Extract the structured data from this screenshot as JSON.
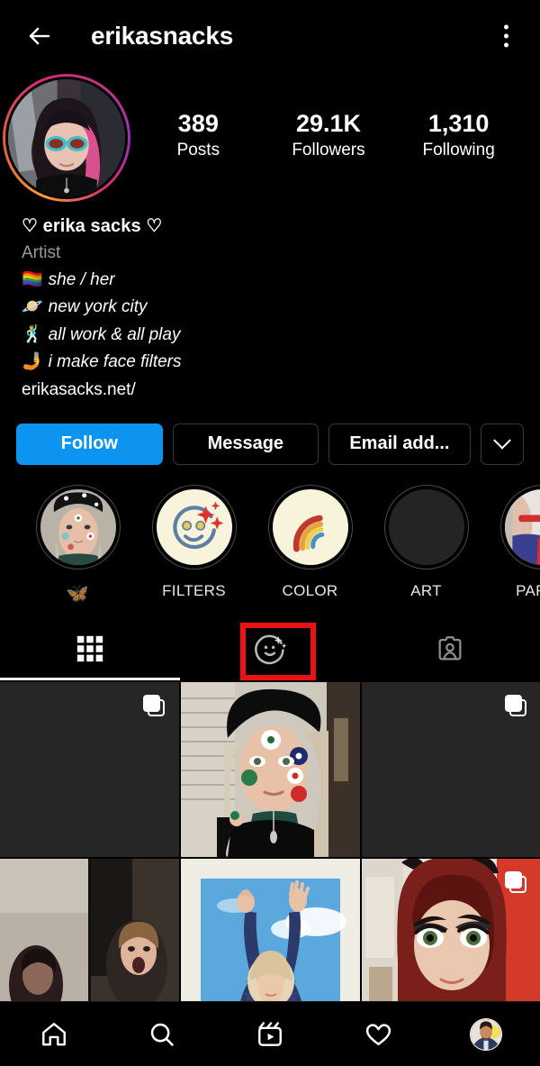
{
  "header": {
    "back_icon": "back-arrow-icon",
    "username": "erikasnacks",
    "menu_icon": "kebab-menu-icon"
  },
  "profile": {
    "avatar_name": "profile-avatar-with-story-ring",
    "has_story_ring": true,
    "stats": [
      {
        "value": "389",
        "label": "Posts"
      },
      {
        "value": "29.1K",
        "label": "Followers"
      },
      {
        "value": "1,310",
        "label": "Following"
      }
    ],
    "bio": {
      "display_name": "♡ erika sacks ♡",
      "category": "Artist",
      "lines": [
        {
          "emoji": "🏳️‍🌈",
          "text": "she / her"
        },
        {
          "emoji": "🪐",
          "text": "new york city"
        },
        {
          "emoji": "🕺",
          "text": "all work & all play"
        },
        {
          "emoji": "🤳",
          "text": "i make face filters"
        }
      ],
      "link": "erikasacks.net/"
    }
  },
  "actions": {
    "follow_label": "Follow",
    "message_label": "Message",
    "email_label": "Email add...",
    "chevron_icon": "chevron-down-icon",
    "follow_color": "#0d94f0"
  },
  "highlights": [
    {
      "label": "🦋",
      "icon": "highlight-cover-selfie",
      "is_emoji": true
    },
    {
      "label": "FILTERS",
      "icon": "highlight-cover-smiley-sparkles",
      "is_emoji": false
    },
    {
      "label": "COLOR",
      "icon": "highlight-cover-rainbow",
      "is_emoji": false
    },
    {
      "label": "ART",
      "icon": "highlight-cover-blank",
      "is_emoji": false
    },
    {
      "label": "PARAD",
      "icon": "highlight-cover-parade",
      "is_emoji": false
    }
  ],
  "tabs": [
    {
      "name": "grid-tab",
      "icon": "grid-icon",
      "active": true
    },
    {
      "name": "effects-tab",
      "icon": "face-effects-icon",
      "active": false,
      "highlighted": true
    },
    {
      "name": "tagged-tab",
      "icon": "tagged-person-icon",
      "active": false
    }
  ],
  "annotation": {
    "box_color": "#ee1111",
    "target": "effects-tab"
  },
  "grid": {
    "cells": [
      {
        "name": "post-dark-carousel-1",
        "carousel": true
      },
      {
        "name": "post-beret-flowers-selfie",
        "carousel": false
      },
      {
        "name": "post-dark-carousel-2",
        "carousel": true
      },
      {
        "name": "post-video-call-two-women",
        "carousel": false
      },
      {
        "name": "post-arms-up-sky",
        "carousel": false
      },
      {
        "name": "post-red-hair-cat-ears",
        "carousel": true
      }
    ]
  },
  "bottom_nav": [
    {
      "name": "home-icon"
    },
    {
      "name": "search-icon"
    },
    {
      "name": "reels-icon"
    },
    {
      "name": "activity-heart-icon"
    },
    {
      "name": "profile-avatar-icon"
    }
  ]
}
